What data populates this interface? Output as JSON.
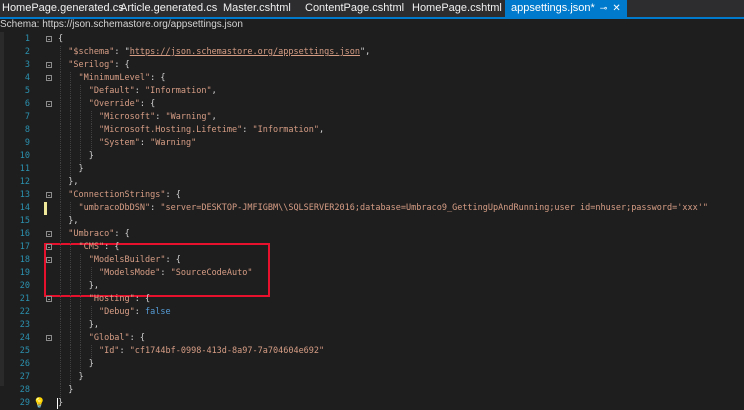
{
  "tabs": [
    {
      "label": "HomePage.generated.cs"
    },
    {
      "label": "Article.generated.cs"
    },
    {
      "label": "Master.cshtml"
    },
    {
      "label": "ContentPage.cshtml"
    },
    {
      "label": "HomePage.cshtml"
    },
    {
      "label": "appsettings.json*",
      "active": true,
      "pin_icon": "pin-icon",
      "close_icon": "close-icon"
    }
  ],
  "schema_bar": "Schema: https://json.schemastore.org/appsettings.json",
  "lines": [
    {
      "n": "1",
      "text": "{"
    },
    {
      "n": "2",
      "text": "  \"$schema\": \"https://json.schemastore.org/appsettings.json\","
    },
    {
      "n": "3",
      "text": "  \"Serilog\": {"
    },
    {
      "n": "4",
      "text": "    \"MinimumLevel\": {"
    },
    {
      "n": "5",
      "text": "      \"Default\": \"Information\","
    },
    {
      "n": "6",
      "text": "      \"Override\": {"
    },
    {
      "n": "7",
      "text": "        \"Microsoft\": \"Warning\","
    },
    {
      "n": "8",
      "text": "        \"Microsoft.Hosting.Lifetime\": \"Information\","
    },
    {
      "n": "9",
      "text": "        \"System\": \"Warning\""
    },
    {
      "n": "10",
      "text": "      }"
    },
    {
      "n": "11",
      "text": "    }"
    },
    {
      "n": "12",
      "text": "  },"
    },
    {
      "n": "13",
      "text": "  \"ConnectionStrings\": {"
    },
    {
      "n": "14",
      "text": "    \"umbracoDbDSN\": \"server=DESKTOP-JMFIGBM\\\\SQLSERVER2016;database=Umbraco9_GettingUpAndRunning;user id=nhuser;password='xxx'\""
    },
    {
      "n": "15",
      "text": "  },"
    },
    {
      "n": "16",
      "text": "  \"Umbraco\": {"
    },
    {
      "n": "17",
      "text": "    \"CMS\": {"
    },
    {
      "n": "18",
      "text": "      \"ModelsBuilder\": {"
    },
    {
      "n": "19",
      "text": "        \"ModelsMode\": \"SourceCodeAuto\""
    },
    {
      "n": "20",
      "text": "      },"
    },
    {
      "n": "21",
      "text": "      \"Hosting\": {"
    },
    {
      "n": "22",
      "text": "        \"Debug\": false"
    },
    {
      "n": "23",
      "text": "      },"
    },
    {
      "n": "24",
      "text": "      \"Global\": {"
    },
    {
      "n": "25",
      "text": "        \"Id\": \"cf1744bf-0998-413d-8a97-7a704604e692\""
    },
    {
      "n": "26",
      "text": "      }"
    },
    {
      "n": "27",
      "text": "    }"
    },
    {
      "n": "28",
      "text": "  }"
    },
    {
      "n": "29",
      "text": "}"
    }
  ],
  "colors": {
    "accent": "#007acc",
    "keyword": "#569cd6",
    "string": "#d69d85",
    "line_number": "#2b91af",
    "highlight_box": "#e8112d"
  },
  "gutter_icons": {
    "line29": "lightbulb-icon"
  }
}
